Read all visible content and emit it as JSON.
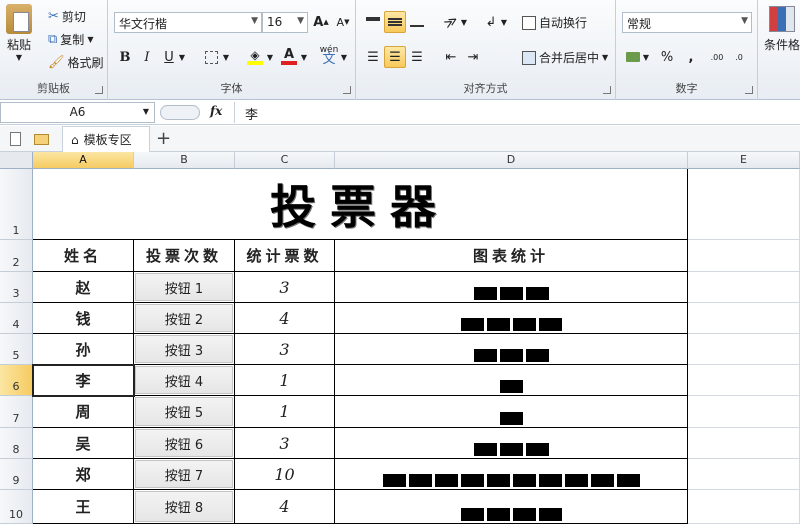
{
  "ribbon": {
    "clipboard": {
      "paste": "粘贴",
      "cut": "剪切",
      "copy": "复制",
      "format_painter": "格式刷",
      "label": "剪贴板"
    },
    "font": {
      "family": "华文行楷",
      "size": "16",
      "bold": "B",
      "italic": "I",
      "underline": "U",
      "phonetic": "wén",
      "label": "字体"
    },
    "alignment": {
      "wrap": "自动换行",
      "merge": "合并后居中",
      "label": "对齐方式"
    },
    "number": {
      "format": "常规",
      "percent": "%",
      "comma": ",",
      "label": "数字"
    },
    "styles": {
      "conditional": "条件格"
    }
  },
  "formula_bar": {
    "cell_ref": "A6",
    "fx": "fx",
    "content": "李"
  },
  "tabs": {
    "template": "模板专区",
    "add": "+"
  },
  "grid": {
    "columns": [
      "A",
      "B",
      "C",
      "D",
      "E"
    ],
    "rows": [
      "1",
      "2",
      "3",
      "4",
      "5",
      "6",
      "7",
      "8",
      "9",
      "10"
    ],
    "title": "投票器",
    "headers": [
      "姓名",
      "投票次数",
      "统计票数",
      "图表统计"
    ],
    "entries": [
      {
        "name": "赵",
        "button": "按钮 1",
        "count": "3",
        "votes": 3
      },
      {
        "name": "钱",
        "button": "按钮 2",
        "count": "4",
        "votes": 4
      },
      {
        "name": "孙",
        "button": "按钮 3",
        "count": "3",
        "votes": 3
      },
      {
        "name": "李",
        "button": "按钮 4",
        "count": "1",
        "votes": 1
      },
      {
        "name": "周",
        "button": "按钮 5",
        "count": "1",
        "votes": 1
      },
      {
        "name": "吴",
        "button": "按钮 6",
        "count": "3",
        "votes": 3
      },
      {
        "name": "郑",
        "button": "按钮 7",
        "count": "10",
        "votes": 10
      },
      {
        "name": "王",
        "button": "按钮 8",
        "count": "4",
        "votes": 4
      }
    ]
  }
}
